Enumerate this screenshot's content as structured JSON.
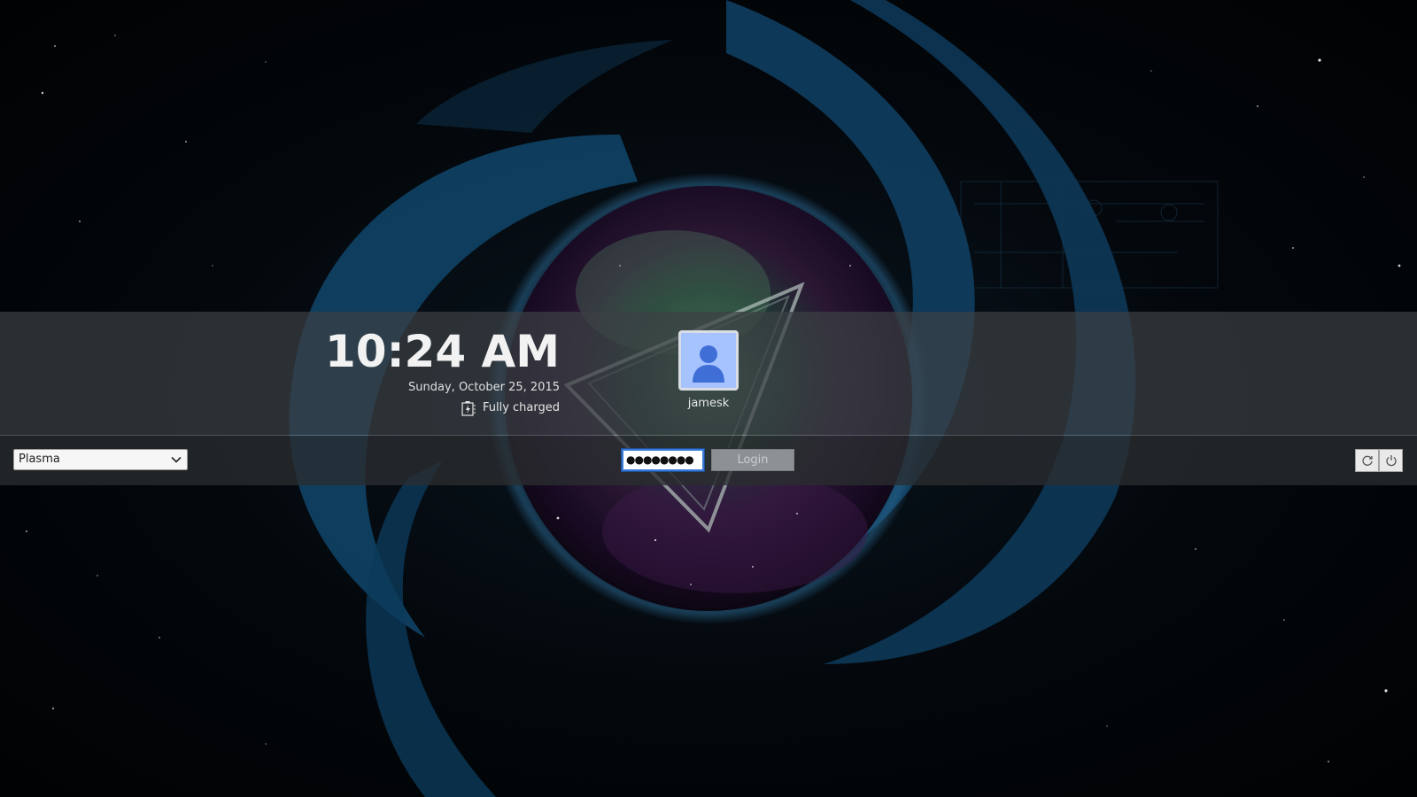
{
  "clock": {
    "time": "10:24 AM",
    "date": "Sunday, October 25, 2015"
  },
  "battery": {
    "icon": "battery-charging-icon",
    "status": "Fully charged"
  },
  "user": {
    "avatar_icon": "user-avatar-icon",
    "name": "jamesk"
  },
  "session": {
    "selected": "Plasma",
    "icon": "chevron-down-icon"
  },
  "login": {
    "password_masked": "●●●●●●●●",
    "button_label": "Login"
  },
  "actions": {
    "restart_icon": "restart-icon",
    "shutdown_icon": "power-icon"
  },
  "colors": {
    "band": "#3c4044",
    "accent": "#3a7bd5",
    "avatar_bg": "#a7c3ff",
    "avatar_figure": "#3f6fd6"
  }
}
